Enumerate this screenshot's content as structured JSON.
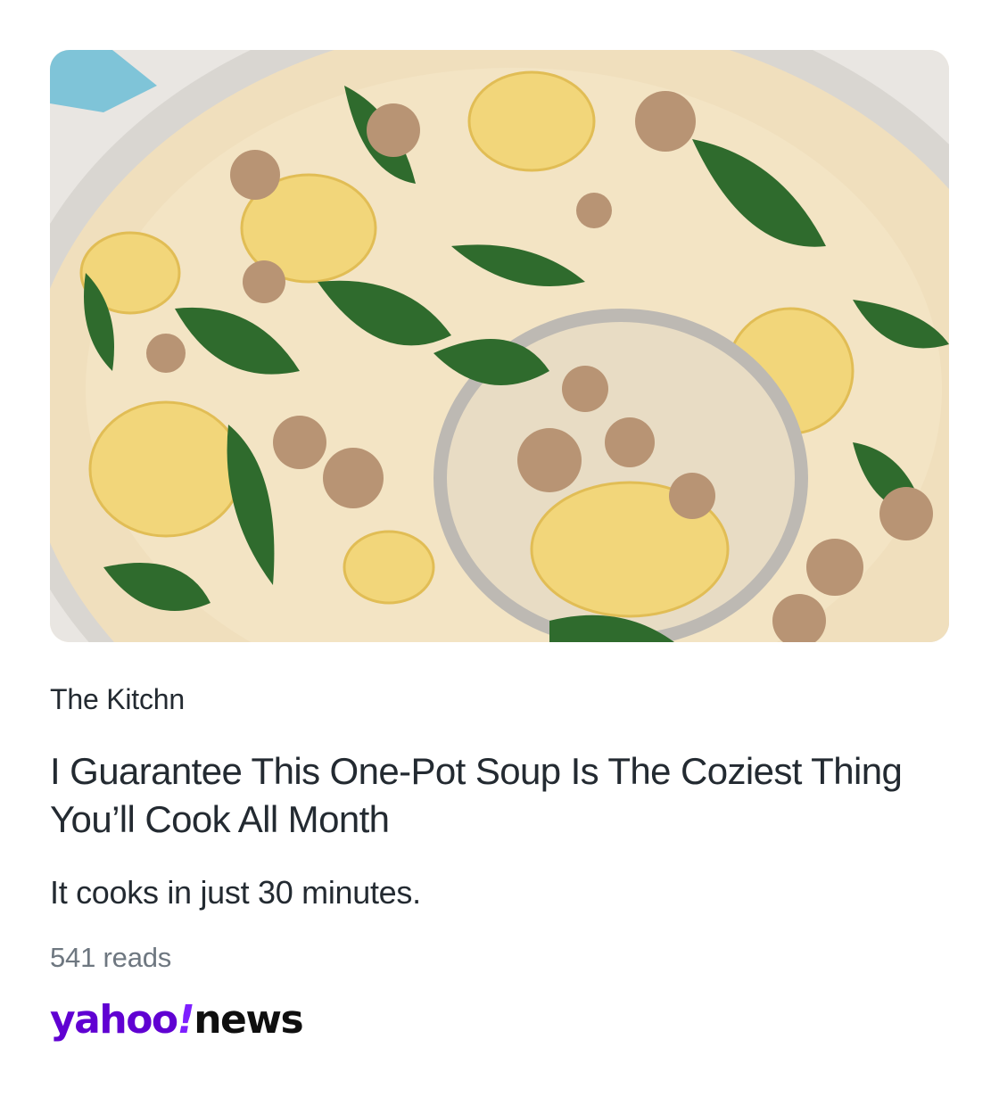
{
  "article": {
    "image_alt": "Creamy tortellini soup with sausage and spinach in a blue pot with a ladle",
    "source": "The Kitchn",
    "title": "I Guarantee This One-Pot Soup Is The Coziest Thing You’ll Cook All Month",
    "summary": "It cooks in just 30 minutes.",
    "reads": "541 reads"
  },
  "brand": {
    "yahoo": "yahoo",
    "bang": "!",
    "news": "news",
    "purple": "#6001d2",
    "accent": "#7e1fff"
  }
}
